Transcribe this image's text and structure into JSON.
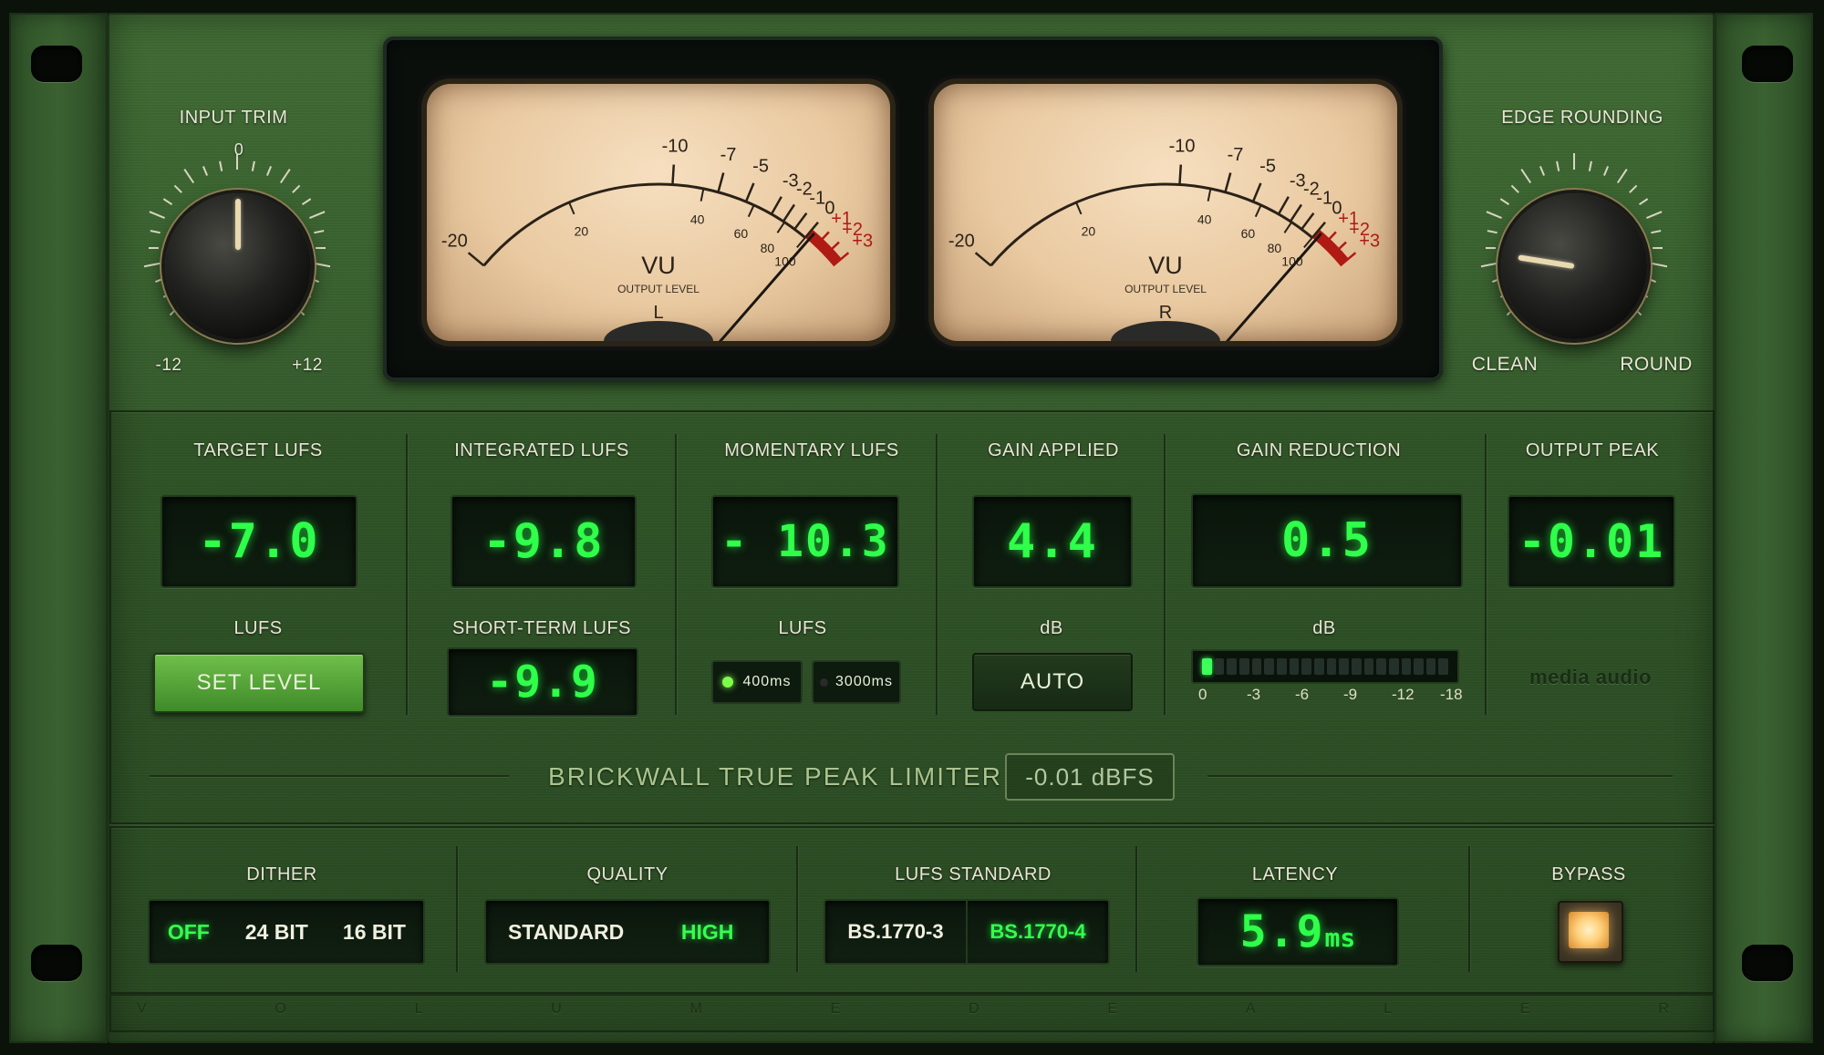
{
  "input_trim": {
    "title": "INPUT TRIM",
    "top": "0",
    "min": "-12",
    "max": "+12",
    "value_db": 0
  },
  "edge_rounding": {
    "title": "EDGE ROUNDING",
    "min": "CLEAN",
    "max": "ROUND",
    "value_fraction": 0.2
  },
  "vu_meters": [
    {
      "channel": "L",
      "title": "VU",
      "subtitle": "OUTPUT LEVEL",
      "needle_vu": 0.3
    },
    {
      "channel": "R",
      "title": "VU",
      "subtitle": "OUTPUT LEVEL",
      "needle_vu": 0.3
    }
  ],
  "vu_scale": {
    "top_labels": [
      "-20",
      "-10",
      "-7",
      "-5",
      "-3",
      "-2",
      "-1",
      "0",
      "+1",
      "+2",
      "+3"
    ],
    "top_values": [
      -20,
      -10,
      -7,
      -5,
      -3,
      -2,
      -1,
      0,
      1,
      2,
      3
    ],
    "percent_labels": [
      "20",
      "40",
      "60",
      "80",
      "100"
    ],
    "percent_values": [
      -16,
      -8,
      -4.4,
      -1.9,
      0
    ]
  },
  "target": {
    "title": "TARGET LUFS",
    "value": "-7.0",
    "unit": "LUFS",
    "button": "SET LEVEL"
  },
  "integrated": {
    "title": "INTEGRATED LUFS",
    "value": "-9.8",
    "st_title": "SHORT-TERM LUFS",
    "st_value": "-9.9"
  },
  "momentary": {
    "title": "MOMENTARY LUFS",
    "value": "- 10.3",
    "unit": "LUFS",
    "opt1": "400ms",
    "opt2": "3000ms"
  },
  "gain_applied": {
    "title": "GAIN APPLIED",
    "value": "4.4",
    "unit": "dB",
    "button": "AUTO"
  },
  "gain_reduction": {
    "title": "GAIN REDUCTION",
    "value": "0.5",
    "unit": "dB",
    "scale": [
      "0",
      "-3",
      "-6",
      "-9",
      "-12",
      "-18"
    ],
    "segments": 20,
    "lit": 1
  },
  "output_peak": {
    "title": "OUTPUT PEAK",
    "value": "-0.01",
    "brand": "media audio"
  },
  "limiter": {
    "title": "BRICKWALL TRUE PEAK LIMITER",
    "value": "-0.01 dBFS"
  },
  "dither": {
    "title": "DITHER",
    "options": [
      "OFF",
      "24 BIT",
      "16 BIT"
    ],
    "selected": "OFF"
  },
  "quality": {
    "title": "QUALITY",
    "options": [
      "STANDARD",
      "HIGH"
    ],
    "selected": "HIGH"
  },
  "lufs_standard": {
    "title": "LUFS STANDARD",
    "options": [
      "BS.1770-3",
      "BS.1770-4"
    ],
    "selected": "BS.1770-4"
  },
  "latency": {
    "title": "LATENCY",
    "value": "5.9",
    "unit": "ms"
  },
  "bypass": {
    "title": "BYPASS"
  },
  "footer": {
    "letters": [
      "V",
      "O",
      "L",
      "U",
      "M",
      "E",
      "D",
      "E",
      "A",
      "L",
      "E",
      "R"
    ]
  },
  "colors": {
    "lcd_green": "#2fff4a",
    "panel_green": "#345a2b",
    "vu_red": "#b01a14",
    "bypass_amber": "#ffcf7a"
  }
}
